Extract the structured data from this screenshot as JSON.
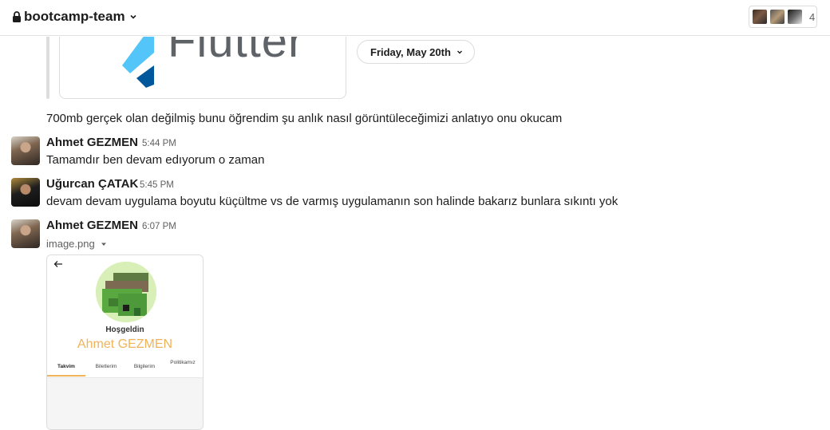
{
  "header": {
    "channel_name": "bootcamp-team",
    "member_count": "4",
    "icons": [
      "lock-icon",
      "chevron-down-icon"
    ]
  },
  "previous_attachment": {
    "logo_text": "Flutter"
  },
  "date_divider": {
    "label": "Friday, May 20th"
  },
  "messages": [
    {
      "author": "",
      "time": "",
      "text": "700mb gerçek olan değilmiş bunu öğrendim şu anlık nasıl görüntüleceğimizi anlatıyo onu okucam"
    },
    {
      "author": "Ahmet GEZMEN",
      "time": "5:44 PM",
      "text": "Tamamdır ben devam edıyorum o zaman"
    },
    {
      "author": "Uğurcan ÇATAK",
      "time": "5:45 PM",
      "text": "devam devam uygulama boyutu küçültme vs de varmış uygulamanın son halinde bakarız bunlara sıkıntı yok"
    },
    {
      "author": "Ahmet GEZMEN",
      "time": "6:07 PM",
      "text": ""
    }
  ],
  "file": {
    "name": "image.png",
    "preview": {
      "welcome": "Hoşgeldin",
      "user_name": "Ahmet GEZMEN",
      "tabs": [
        "Takvim",
        "Biletlerim",
        "Bilgilerim",
        "Politikamız"
      ]
    }
  },
  "colors": {
    "text": "#1d1c1d",
    "muted": "#616061",
    "border": "#dcdcdc",
    "accent_orange": "#f1b35a",
    "flutter_blue": "#02569B"
  }
}
